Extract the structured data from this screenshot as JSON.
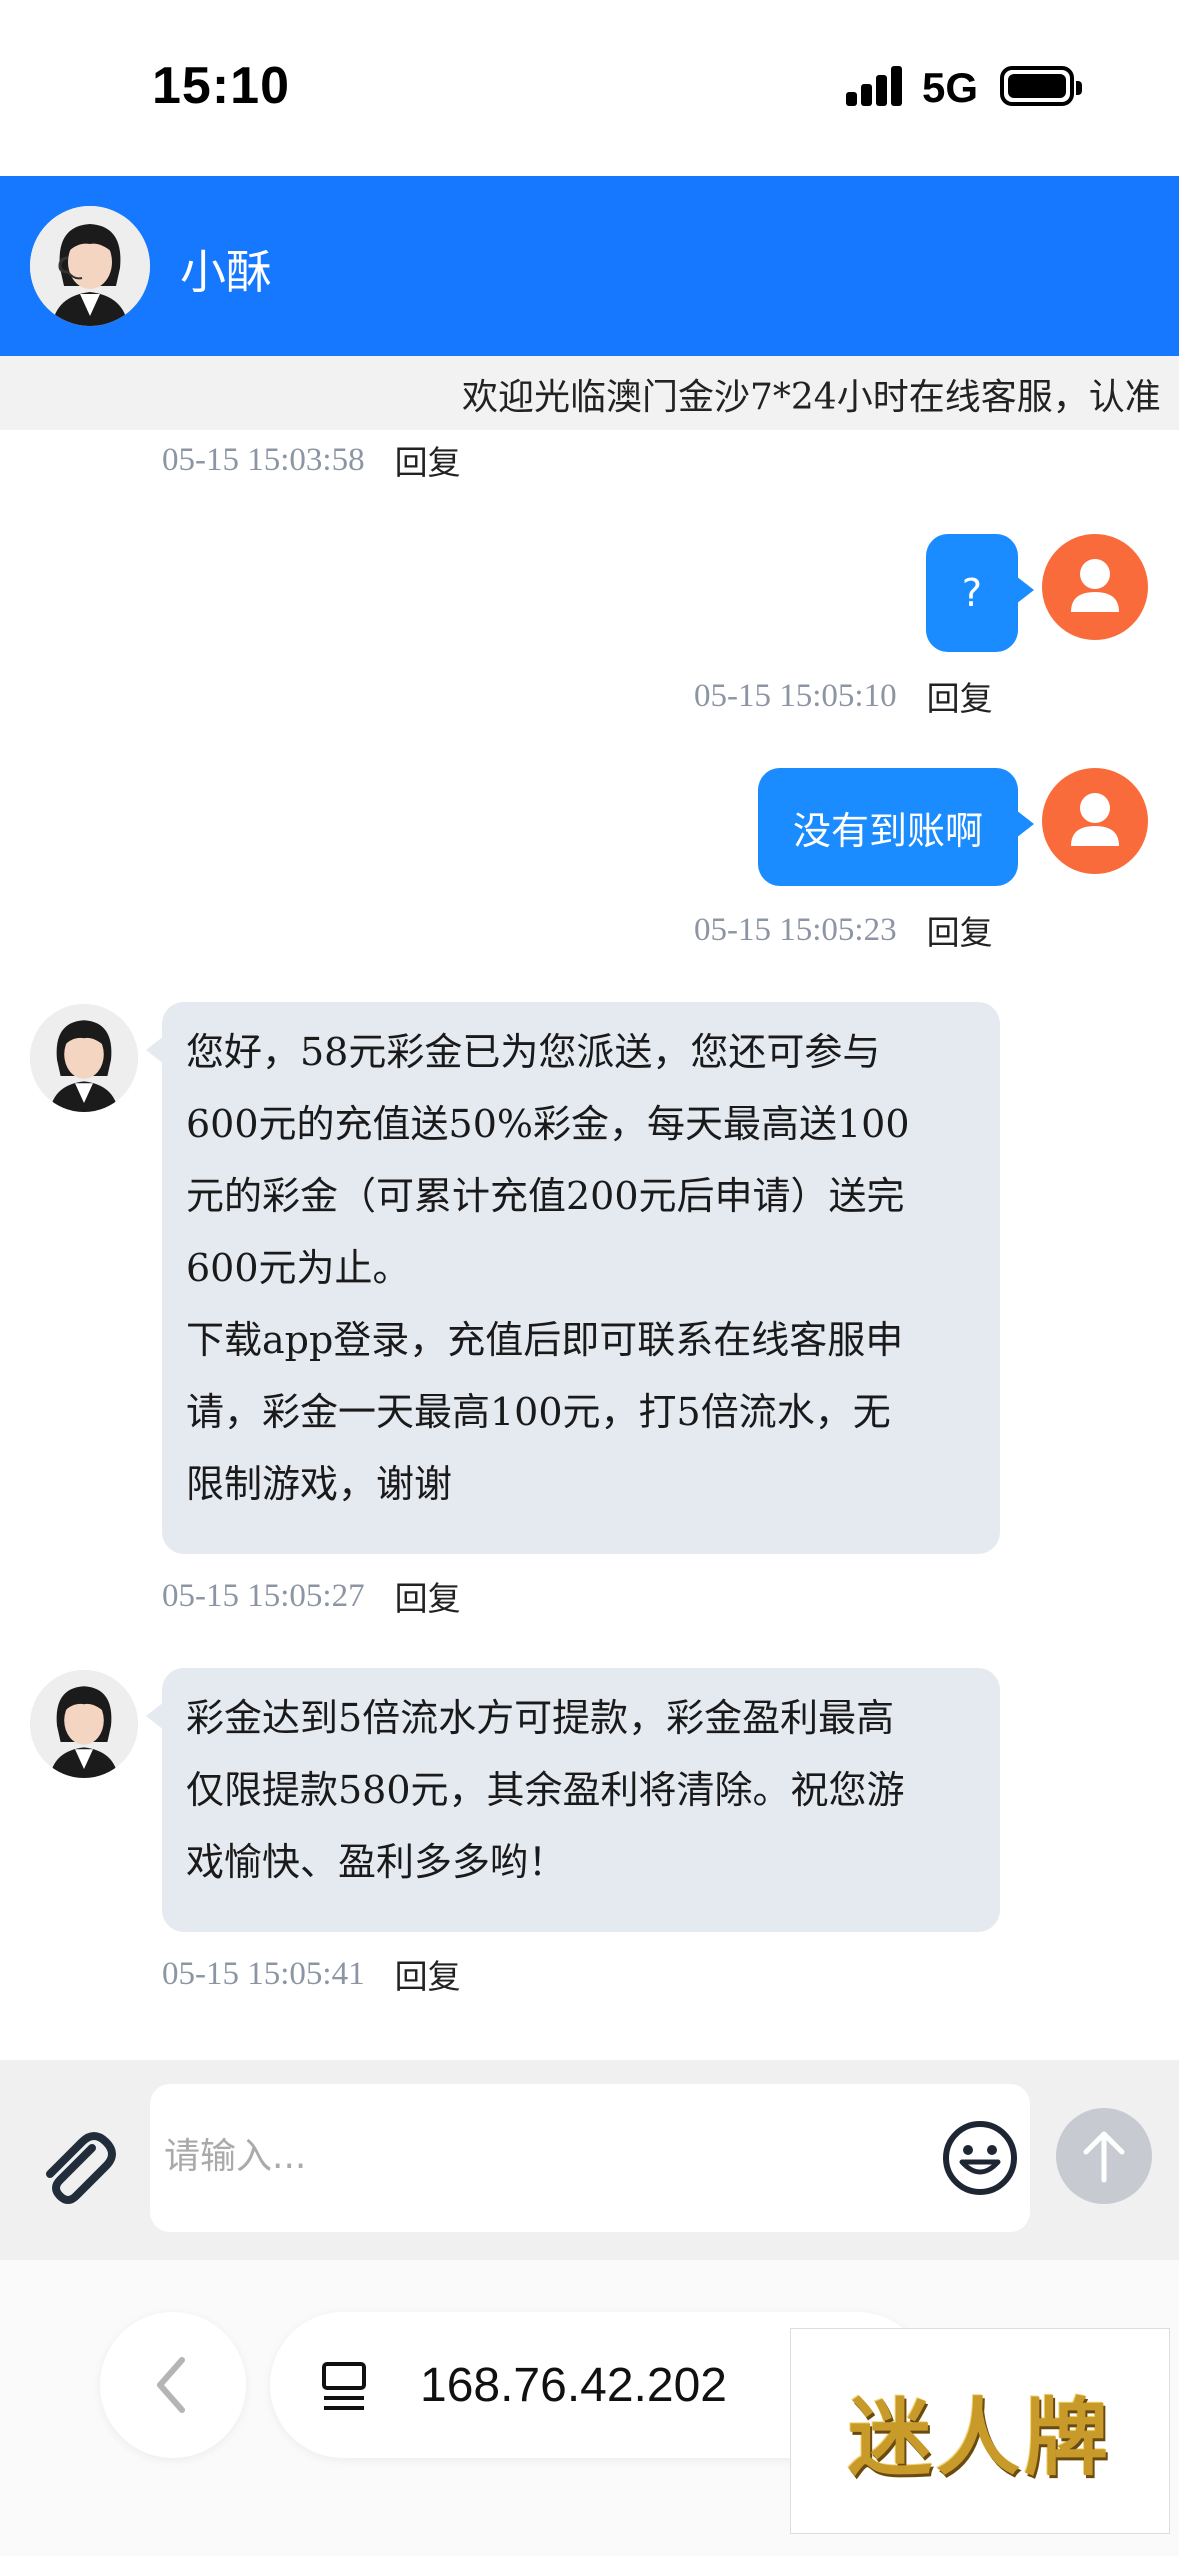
{
  "status_bar": {
    "time": "15:10",
    "network": "5G"
  },
  "header": {
    "agent_name": "小酥",
    "background": "#1677ff"
  },
  "marquee": {
    "text": "欢迎光临澳门金沙7*24小时在线客服，认准"
  },
  "messages": [
    {
      "side": "meta-only",
      "time": "05-15 15:03:58",
      "reply": "回复"
    },
    {
      "side": "right",
      "text": "?",
      "time": "05-15 15:05:10",
      "reply": "回复"
    },
    {
      "side": "right",
      "text": "没有到账啊",
      "time": "05-15 15:05:23",
      "reply": "回复"
    },
    {
      "side": "left",
      "text": "您好，58元彩金已为您派送，您还可参与\n600元的充值送50%彩金，每天最高送100\n元的彩金（可累计充值200元后申请）送完\n600元为止。\n下载app登录，充值后即可联系在线客服申\n请，彩金一天最高100元，打5倍流水，无\n限制游戏，谢谢",
      "time": "05-15 15:05:27",
      "reply": "回复"
    },
    {
      "side": "left",
      "text": "彩金达到5倍流水方可提款，彩金盈利最高\n仅限提款580元，其余盈利将清除。祝您游\n戏愉快、盈利多多哟！",
      "time": "05-15 15:05:41",
      "reply": "回复"
    }
  ],
  "input": {
    "placeholder": "请输入..."
  },
  "browser": {
    "url": "168.76.42.202"
  },
  "watermark": {
    "text": "迷人牌"
  },
  "icons": {
    "attach": "paperclip-icon",
    "emoji": "smile-icon",
    "send": "arrow-up-icon",
    "back": "chevron-left-icon",
    "url": "tab-list-icon",
    "user_avatar": "person-icon"
  },
  "colors": {
    "user_bubble": "#1a8cff",
    "agent_bubble": "#e5e9f0",
    "user_avatar": "#fa6b3c",
    "timestamp": "#8c95a3"
  }
}
